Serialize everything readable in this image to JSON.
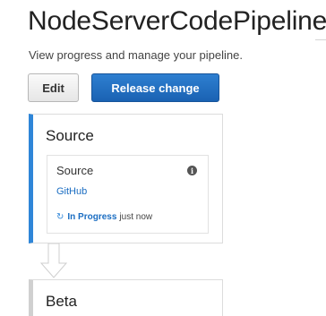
{
  "pipeline": {
    "name": "NodeServerCodePipeline",
    "description": "View progress and manage your pipeline."
  },
  "toolbar": {
    "edit_label": "Edit",
    "release_label": "Release change"
  },
  "stages": [
    {
      "name": "Source",
      "action": {
        "name": "Source",
        "provider": "GitHub",
        "status": "In Progress",
        "time": "just now",
        "status_icon": "refresh-icon",
        "info_icon": "info-icon"
      }
    },
    {
      "name": "Beta"
    }
  ],
  "colors": {
    "accent": "#2f86d8",
    "link": "#1a6dc2",
    "primary_button": "#1a62b3"
  }
}
